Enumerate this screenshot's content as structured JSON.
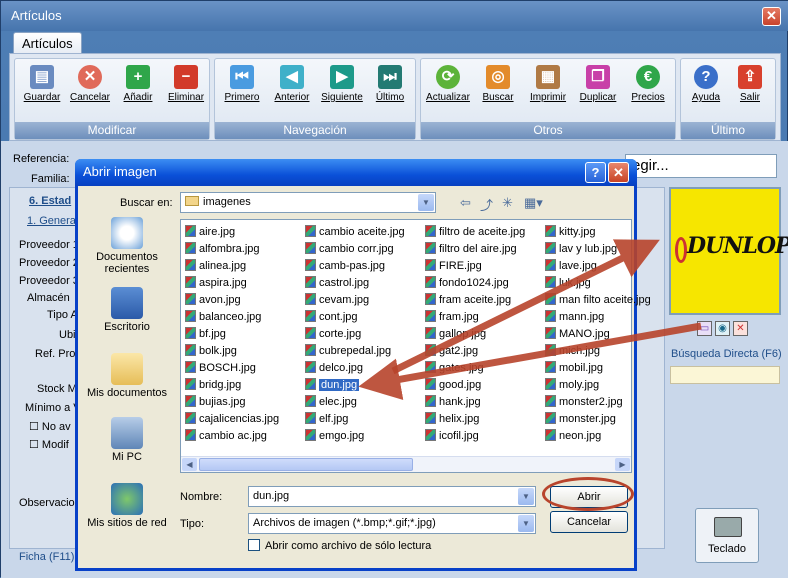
{
  "app": {
    "title": "Artículos",
    "tab": "Artículos"
  },
  "ribbon": {
    "groups": [
      {
        "label": "Modificar",
        "buttons": [
          "Guardar",
          "Cancelar",
          "Añadir",
          "Eliminar"
        ]
      },
      {
        "label": "Navegación",
        "buttons": [
          "Primero",
          "Anterior",
          "Siguiente",
          "Último"
        ]
      },
      {
        "label": "Otros",
        "buttons": [
          "Actualizar",
          "Buscar",
          "Imprimir",
          "Duplicar",
          "Precios"
        ]
      },
      {
        "label": "Último",
        "buttons": [
          "Ayuda",
          "Salir"
        ]
      }
    ]
  },
  "background": {
    "referencia_label": "Referencia:",
    "familia_label": "Familia:",
    "tab6": "6. Estad",
    "tab1": "1. General",
    "proveedor1": "Proveedor 1",
    "proveedor2": "Proveedor 2",
    "proveedor3": "Proveedor 3",
    "almacen": "Almacén",
    "tipo": "Tipo A",
    "ubi": "Ubi",
    "refprov": "Ref. Prov",
    "stock": "Stock M",
    "minimo": "Mínimo a V",
    "no_av": "No av",
    "modif": "Modif",
    "observacion": "Observacio",
    "ficha": "Ficha (F11)",
    "combo_right": "egir...",
    "busqueda": "Búsqueda Directa (F6)",
    "teclado": "Teclado",
    "logo_text": "DUNLOP"
  },
  "dialog": {
    "title": "Abrir imagen",
    "buscar_en_label": "Buscar en:",
    "buscar_en_value": "imagenes",
    "places": [
      "Documentos recientes",
      "Escritorio",
      "Mis documentos",
      "Mi PC",
      "Mis sitios de red"
    ],
    "files": [
      [
        "aire.jpg",
        "alfombra.jpg",
        "alinea.jpg",
        "aspira.jpg",
        "avon.jpg",
        "balanceo.jpg",
        "bf.jpg",
        "bolk.jpg",
        "BOSCH.jpg",
        "bridg.jpg",
        "bujias.jpg",
        "cajalicencias.jpg",
        "cambio ac.jpg"
      ],
      [
        "cambio aceite.jpg",
        "cambio corr.jpg",
        "camb-pas.jpg",
        "castrol.jpg",
        "cevam.jpg",
        "cont.jpg",
        "corte.jpg",
        "cubrepedal.jpg",
        "delco.jpg",
        "dun.jpg",
        "elec.jpg",
        "elf.jpg",
        "emgo.jpg"
      ],
      [
        "filtro de aceite.jpg",
        "filtro del aire.jpg",
        "FIRE.jpg",
        "fondo1024.jpg",
        "fram aceite.jpg",
        "fram.jpg",
        "gallop.jpg",
        "gat2.jpg",
        "gates.jpg",
        "good.jpg",
        "hank.jpg",
        "helix.jpg",
        "icofil.jpg"
      ],
      [
        "kitty.jpg",
        "lav y lub.jpg",
        "lave.jpg",
        "luk.jpg",
        "man filto aceite.jpg",
        "mann.jpg",
        "MANO.jpg",
        "mich.jpg",
        "mobil.jpg",
        "moly.jpg",
        "monster2.jpg",
        "monster.jpg",
        "neon.jpg"
      ]
    ],
    "selected_file": "dun.jpg",
    "nombre_label": "Nombre:",
    "nombre_value": "dun.jpg",
    "tipo_label": "Tipo:",
    "tipo_value": "Archivos de imagen (*.bmp;*.gif;*.jpg)",
    "readonly_label": "Abrir como archivo de sólo lectura",
    "abrir": "Abrir",
    "cancelar": "Cancelar"
  }
}
